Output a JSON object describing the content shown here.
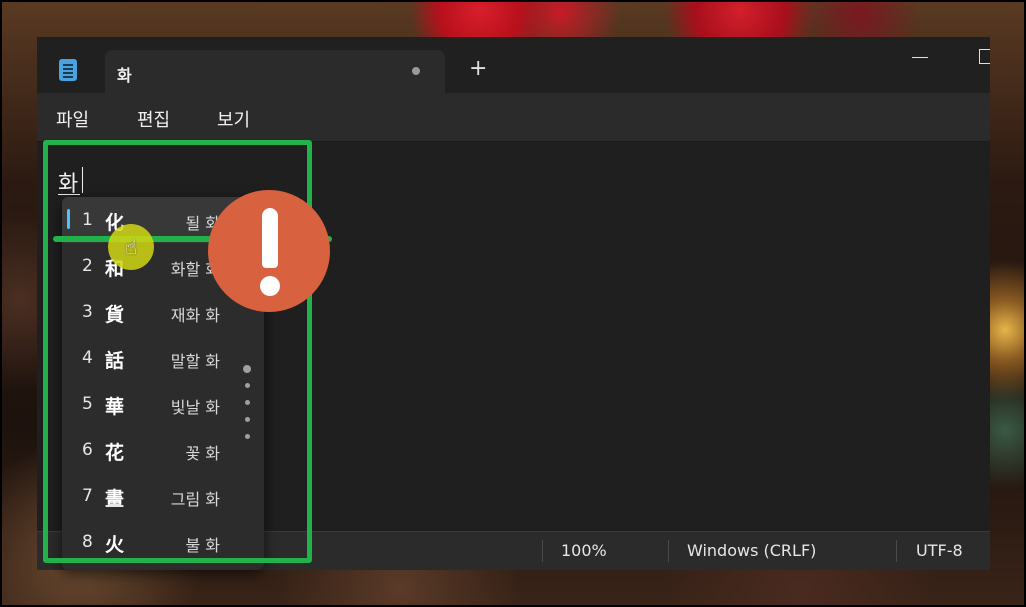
{
  "window": {
    "tab_title": "화",
    "new_tab_label": "+",
    "menu": [
      "파일",
      "편집",
      "보기"
    ]
  },
  "editor": {
    "typed_text": "화"
  },
  "candidates": [
    {
      "num": "1",
      "char": "化",
      "meaning": "될 화",
      "selected": true
    },
    {
      "num": "2",
      "char": "和",
      "meaning": "화할 화"
    },
    {
      "num": "3",
      "char": "貨",
      "meaning": "재화 화"
    },
    {
      "num": "4",
      "char": "話",
      "meaning": "말할 화"
    },
    {
      "num": "5",
      "char": "華",
      "meaning": "빛날 화"
    },
    {
      "num": "6",
      "char": "花",
      "meaning": "꽃 화"
    },
    {
      "num": "7",
      "char": "畫",
      "meaning": "그림 화"
    },
    {
      "num": "8",
      "char": "火",
      "meaning": "불 화"
    }
  ],
  "status": {
    "zoom": "100%",
    "line_ending": "Windows (CRLF)",
    "encoding": "UTF-8"
  },
  "colors": {
    "highlight": "#21b34a",
    "alert": "#d8613f",
    "accent": "#4cc2ff"
  },
  "icons": {
    "app": "notepad-icon",
    "alert": "exclamation-icon",
    "cursor": "hand-cursor-icon"
  }
}
